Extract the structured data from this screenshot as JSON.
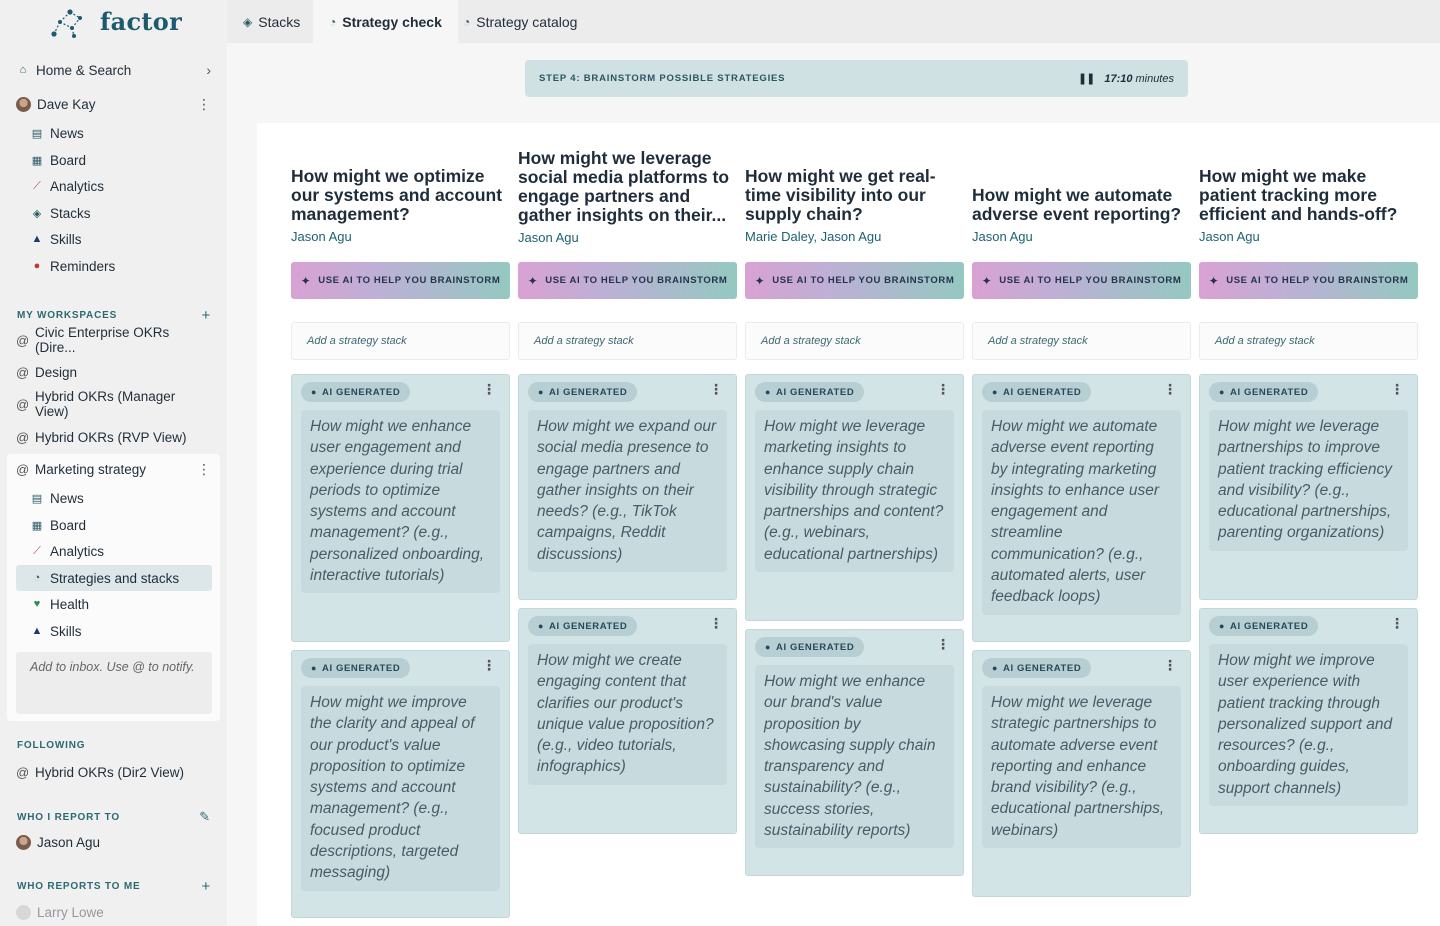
{
  "brand": {
    "name": "factor"
  },
  "tabs": [
    {
      "label": "Stacks",
      "icon": "stack-icon"
    },
    {
      "label": "Strategy check",
      "icon": "gauge-icon"
    },
    {
      "label": "Strategy catalog",
      "icon": "gauge-icon"
    }
  ],
  "sidebar": {
    "home_label": "Home & Search",
    "user_name": "Dave Kay",
    "user_items": [
      {
        "label": "News",
        "icon": "news-icon"
      },
      {
        "label": "Board",
        "icon": "board-icon"
      },
      {
        "label": "Analytics",
        "icon": "analytics-icon"
      },
      {
        "label": "Stacks",
        "icon": "stack-icon"
      },
      {
        "label": "Skills",
        "icon": "skills-icon"
      },
      {
        "label": "Reminders",
        "icon": "bell-icon"
      }
    ],
    "my_workspaces_label": "MY WORKSPACES",
    "workspaces": [
      {
        "label": "Civic Enterprise OKRs (Dire..."
      },
      {
        "label": "Design"
      },
      {
        "label": "Hybrid OKRs (Manager View)"
      },
      {
        "label": "Hybrid OKRs (RVP View)"
      }
    ],
    "active_workspace": {
      "label": "Marketing strategy",
      "items": [
        {
          "label": "News",
          "icon": "news-icon"
        },
        {
          "label": "Board",
          "icon": "board-icon"
        },
        {
          "label": "Analytics",
          "icon": "analytics-icon"
        },
        {
          "label": "Strategies and stacks",
          "icon": "gauge-icon"
        },
        {
          "label": "Health",
          "icon": "health-icon"
        },
        {
          "label": "Skills",
          "icon": "skills-icon"
        }
      ],
      "inbox_placeholder": "Add to inbox. Use @ to notify."
    },
    "following_label": "FOLLOWING",
    "following": [
      {
        "label": "Hybrid OKRs (Dir2 View)"
      }
    ],
    "who_i_report_to_label": "WHO I REPORT TO",
    "report_to": [
      {
        "label": "Jason Agu"
      }
    ],
    "who_reports_to_me_label": "WHO REPORTS TO ME",
    "reports": [
      {
        "label": "Larry Lowe"
      }
    ]
  },
  "step": {
    "label": "STEP 4: BRAINSTORM POSSIBLE STRATEGIES",
    "timer": "17:10",
    "timer_unit": "minutes"
  },
  "ai_button_label": "USE AI TO HELP YOU BRAINSTORM",
  "add_stack_placeholder": "Add a strategy stack",
  "badge_label": "AI GENERATED",
  "columns": [
    {
      "title": "How might we optimize our systems and account management?",
      "authors": "Jason Agu",
      "cards": [
        "How might we enhance user engagement and experience during trial periods to optimize systems and account management? (e.g., personalized onboarding, interactive tutorials)",
        "How might we improve the clarity and appeal of our product's value proposition to optimize systems and account management? (e.g., focused product descriptions, targeted messaging)"
      ]
    },
    {
      "title": "How might we leverage social media platforms to engage partners and gather insights on their...",
      "authors": "Jason Agu",
      "cards": [
        "How might we expand our social media presence to engage partners and gather insights on their needs? (e.g., TikTok campaigns, Reddit discussions)",
        "How might we create engaging content that clarifies our product's unique value proposition? (e.g., video tutorials, infographics)"
      ]
    },
    {
      "title": "How might we get real-time visibility into our supply chain?",
      "authors": "Marie Daley,  Jason Agu",
      "cards": [
        "How might we leverage marketing insights to enhance supply chain visibility through strategic partnerships and content? (e.g., webinars, educational partnerships)",
        "How might we enhance our brand's value proposition by showcasing supply chain transparency and sustainability? (e.g., success stories, sustainability reports)"
      ]
    },
    {
      "title": "How might we automate adverse event reporting?",
      "authors": "Jason Agu",
      "cards": [
        "How might we automate adverse event reporting by integrating marketing insights to enhance user engagement and streamline communication? (e.g., automated alerts, user feedback loops)",
        "How might we leverage strategic partnerships to automate adverse event reporting and enhance brand visibility? (e.g., educational partnerships, webinars)"
      ]
    },
    {
      "title": "How might we make patient tracking more efficient and hands-off?",
      "authors": "Jason Agu",
      "cards": [
        "How might we leverage partnerships to improve patient tracking efficiency and visibility? (e.g., educational partnerships, parenting organizations)",
        "How might we improve user experience with patient tracking through personalized support and resources? (e.g., onboarding guides, support channels)"
      ]
    }
  ]
}
